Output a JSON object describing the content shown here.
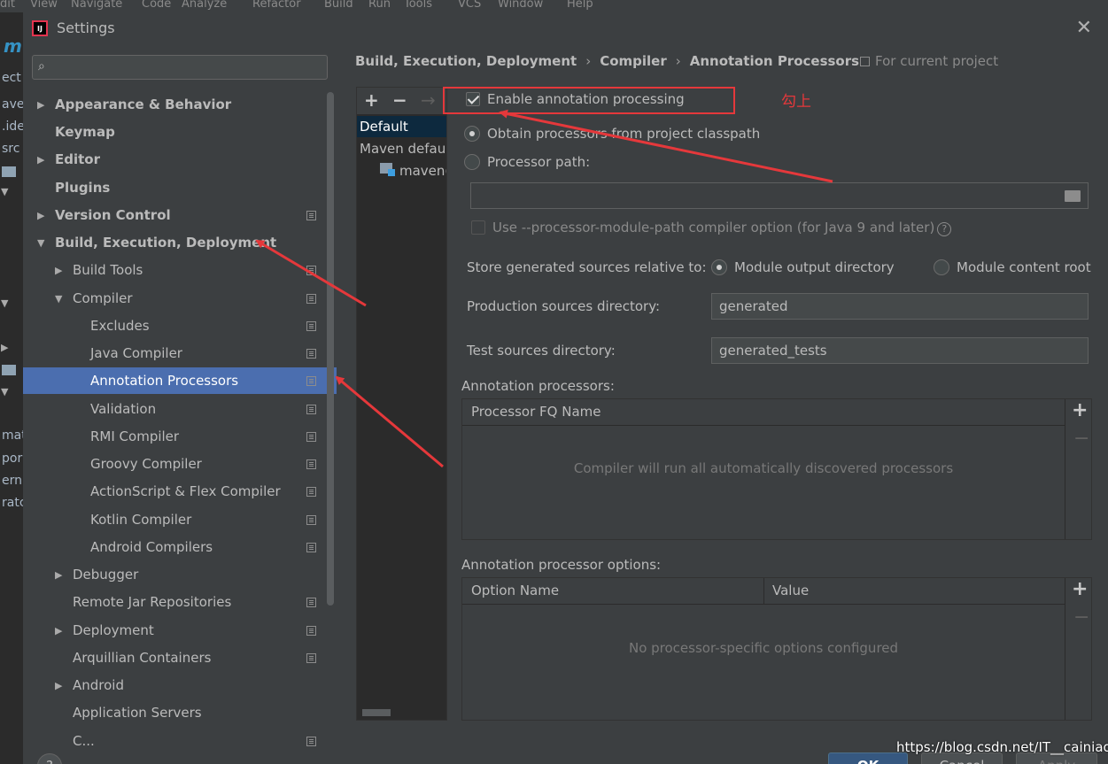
{
  "background": {
    "menubar_text": [
      "dit",
      "View",
      "Navigate",
      "Code",
      "Analyze",
      "Refactor",
      "Build",
      "Run",
      "Tools",
      "VCS",
      "Window",
      "Help"
    ],
    "left_fragments": [
      "ect",
      "aven",
      ".ide",
      "src",
      "mat",
      "por",
      "ern",
      "ratc"
    ]
  },
  "window": {
    "title": "Settings",
    "close_label": "✕",
    "app_icon_text": "IJ"
  },
  "sidebar": {
    "search_placeholder": "",
    "items": [
      {
        "label": "Appearance & Behavior",
        "arrow": "▶"
      },
      {
        "label": "Keymap",
        "arrow": ""
      },
      {
        "label": "Editor",
        "arrow": "▶"
      },
      {
        "label": "Plugins",
        "arrow": ""
      },
      {
        "label": "Version Control",
        "arrow": "▶"
      },
      {
        "label": "Build, Execution, Deployment",
        "arrow": "▼"
      },
      {
        "label": "Build Tools",
        "arrow": "▶"
      },
      {
        "label": "Compiler",
        "arrow": "▼"
      },
      {
        "label": "Excludes",
        "arrow": ""
      },
      {
        "label": "Java Compiler",
        "arrow": ""
      },
      {
        "label": "Annotation Processors",
        "arrow": ""
      },
      {
        "label": "Validation",
        "arrow": ""
      },
      {
        "label": "RMI Compiler",
        "arrow": ""
      },
      {
        "label": "Groovy Compiler",
        "arrow": ""
      },
      {
        "label": "ActionScript & Flex Compiler",
        "arrow": ""
      },
      {
        "label": "Kotlin Compiler",
        "arrow": ""
      },
      {
        "label": "Android Compilers",
        "arrow": ""
      },
      {
        "label": "Debugger",
        "arrow": "▶"
      },
      {
        "label": "Remote Jar Repositories",
        "arrow": ""
      },
      {
        "label": "Deployment",
        "arrow": "▶"
      },
      {
        "label": "Arquillian Containers",
        "arrow": ""
      },
      {
        "label": "Android",
        "arrow": "▶"
      },
      {
        "label": "Application Servers",
        "arrow": ""
      },
      {
        "label": "C...",
        "arrow": ""
      }
    ]
  },
  "breadcrumb": {
    "parts": [
      "Build, Execution, Deployment",
      "Compiler",
      "Annotation Processors"
    ],
    "separator": "›",
    "for_project": "For current project"
  },
  "profiles": {
    "toolbar": {
      "add": "+",
      "remove": "−",
      "move": "→"
    },
    "items": [
      "Default",
      "Maven default",
      "maven("
    ]
  },
  "options": {
    "enable_label": "Enable annotation processing",
    "enable_checked": true,
    "obtain_label": "Obtain processors from project classpath",
    "obtain_selected": true,
    "processor_path_label": "Processor path:",
    "processor_path_value": "",
    "module_path_label": "Use --processor-module-path compiler option (for Java 9 and later)",
    "help_glyph": "?",
    "store_label": "Store generated sources relative to:",
    "store_option_1": "Module output directory",
    "store_option_2": "Module content root",
    "store_selected": "Module output directory",
    "production_label": "Production sources directory:",
    "production_value": "generated",
    "test_label": "Test sources directory:",
    "test_value": "generated_tests"
  },
  "processors_table": {
    "title": "Annotation processors:",
    "column": "Processor FQ Name",
    "empty_text": "Compiler will run all automatically discovered processors",
    "add": "+",
    "remove": "−"
  },
  "options_table": {
    "title": "Annotation processor options:",
    "columns": [
      "Option Name",
      "Value"
    ],
    "empty_text": "No processor-specific options configured",
    "add": "+",
    "remove": "−"
  },
  "buttons": {
    "help": "?",
    "ok": "OK",
    "cancel": "Cancel",
    "apply": "Apply"
  },
  "annotation": {
    "note": "勾上",
    "color": "#e5383b"
  },
  "watermark": "https://blog.csdn.net/IT__cainiao",
  "colors": {
    "selection": "#4b6eaf",
    "dialog_bg": "#3c3f41",
    "editor_bg": "#2b2b2b",
    "text": "#bbbbbb"
  }
}
